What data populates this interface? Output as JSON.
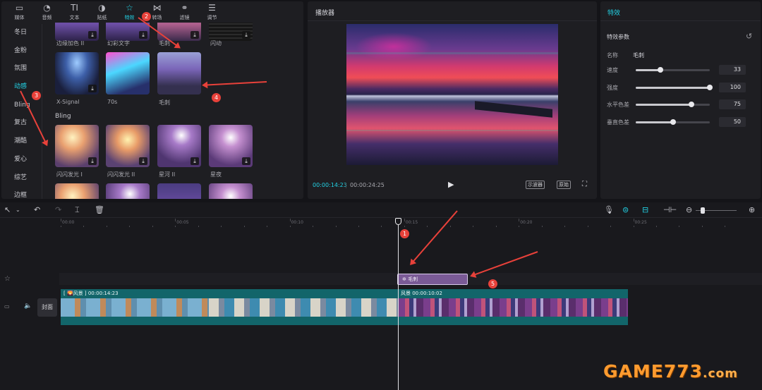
{
  "toolbar": [
    {
      "icon": "media-icon",
      "glyph": "▭",
      "label": "媒体",
      "active": false
    },
    {
      "icon": "audio-icon",
      "glyph": "◔",
      "label": "音频",
      "active": false
    },
    {
      "icon": "text-icon",
      "glyph": "TI",
      "label": "文本",
      "active": false
    },
    {
      "icon": "sticker-icon",
      "glyph": "◑",
      "label": "贴纸",
      "active": false
    },
    {
      "icon": "effects-icon",
      "glyph": "☆",
      "label": "特效",
      "active": true
    },
    {
      "icon": "transition-icon",
      "glyph": "⋈",
      "label": "转场",
      "active": false
    },
    {
      "icon": "filter-icon",
      "glyph": "⚭",
      "label": "滤镜",
      "active": false
    },
    {
      "icon": "adjust-icon",
      "glyph": "☰",
      "label": "调节",
      "active": false
    }
  ],
  "categories": [
    "冬日",
    "金粉",
    "氛围",
    "动感",
    "Bling",
    "复古",
    "潮酷",
    "爱心",
    "综艺",
    "边框"
  ],
  "active_category": "动感",
  "effects_grid": {
    "row0_labels": [
      "边缘加色 II",
      "幻彩文字",
      "毛刺",
      "闪动"
    ],
    "row1_labels": [
      "X-Signal",
      "70s",
      "毛刺"
    ],
    "section_bling": "Bling",
    "row2_labels": [
      "闪闪发光 I",
      "闪闪发光 II",
      "星河 II",
      "星夜"
    ]
  },
  "player": {
    "title": "播放器",
    "time_current": "00:00:14:23",
    "time_separator": "|",
    "time_total": "00:00:24:25",
    "oscilloscope_label": "示波器",
    "original_label": "原始"
  },
  "effect_panel": {
    "title": "特效",
    "params_title": "特效参数",
    "name_key": "名称",
    "name_value": "毛刺",
    "params": [
      {
        "label": "速度",
        "value": "33",
        "fraction": 0.33
      },
      {
        "label": "强度",
        "value": "100",
        "fraction": 1.0
      },
      {
        "label": "水平色差",
        "value": "75",
        "fraction": 0.75
      },
      {
        "label": "垂直色差",
        "value": "50",
        "fraction": 0.5
      }
    ]
  },
  "timeline": {
    "ruler_ticks": [
      "00:00",
      "00:05",
      "00:10",
      "00:15",
      "00:20",
      "00:25"
    ],
    "effect_clip_label": "毛刺",
    "cover_label": "封面",
    "clip_a_caption": "[ 🌄风景 ]   00:00:14:23",
    "clip_b_caption": "风景   00:00:10:02"
  },
  "annotations": [
    "1",
    "2",
    "3",
    "4",
    "5"
  ],
  "watermark": {
    "main": "GAME773",
    "sub": ".com"
  }
}
